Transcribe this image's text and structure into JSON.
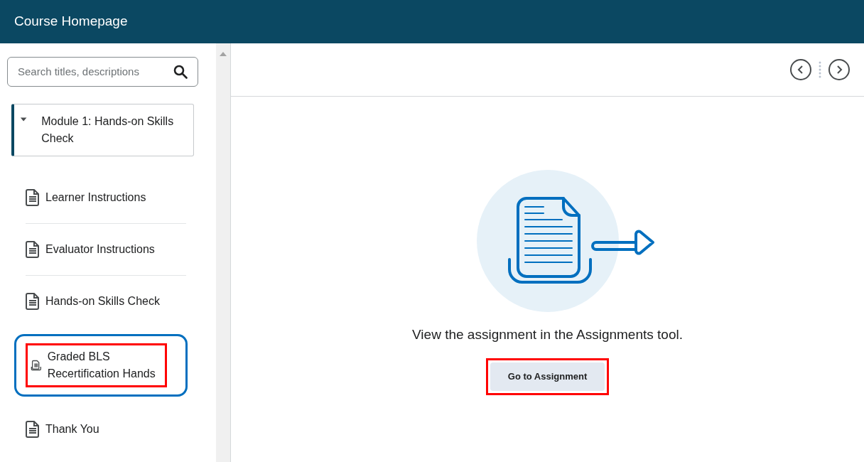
{
  "header": {
    "title": "Course Homepage"
  },
  "search": {
    "placeholder": "Search titles, descriptions"
  },
  "module": {
    "title": "Module 1: Hands-on Skills Check",
    "expanded": true
  },
  "items": [
    {
      "label": "Learner Instructions",
      "kind": "document",
      "selected": false,
      "highlighted": false
    },
    {
      "label": "Evaluator Instructions",
      "kind": "document",
      "selected": false,
      "highlighted": false
    },
    {
      "label": "Hands-on Skills Check",
      "kind": "document",
      "selected": false,
      "highlighted": false
    },
    {
      "label": "Graded BLS Recertification Hands",
      "kind": "assignment",
      "selected": true,
      "highlighted": true
    },
    {
      "label": "Thank You",
      "kind": "document",
      "selected": false,
      "highlighted": false
    }
  ],
  "content": {
    "message": "View the assignment in the Assignments tool.",
    "button": {
      "label": "Go to Assignment",
      "highlighted": true
    }
  }
}
